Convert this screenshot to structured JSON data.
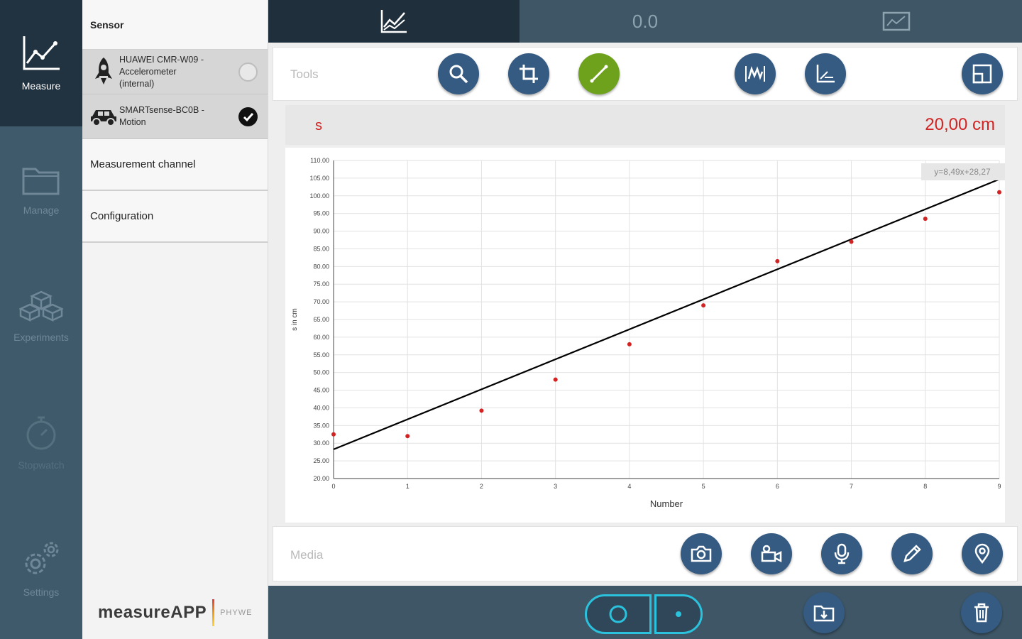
{
  "nav": {
    "items": [
      {
        "label": "Measure",
        "icon": "chart-line-icon",
        "active": true
      },
      {
        "label": "Manage",
        "icon": "folder-icon"
      },
      {
        "label": "Experiments",
        "icon": "cubes-icon"
      },
      {
        "label": "Stopwatch",
        "icon": "stopwatch-icon"
      },
      {
        "label": "Settings",
        "icon": "gears-icon"
      }
    ]
  },
  "panel": {
    "sensor_header": "Sensor",
    "sensors": [
      {
        "line1": "HUAWEI CMR-W09 -",
        "line2": "Accelerometer",
        "line3": "(internal)",
        "selected": false,
        "icon": "rocket-icon"
      },
      {
        "line1": "SMARTsense-BC0B -",
        "line2": "Motion",
        "selected": true,
        "icon": "car-icon"
      }
    ],
    "measurement_channel": "Measurement channel",
    "configuration": "Configuration",
    "brand_app": "measureAPP",
    "brand_company": "PHYWE"
  },
  "topbar": {
    "center_value": "0.0",
    "left_icon": "graph-view-icon",
    "right_icon": "display-view-icon"
  },
  "tools": {
    "label": "Tools",
    "buttons": [
      "zoom-icon",
      "crop-icon",
      "line-fit-icon",
      "curve-fit-icon",
      "axes-icon",
      "expand-icon"
    ]
  },
  "value_bar": {
    "label": "s",
    "value": "20,00 cm"
  },
  "media": {
    "label": "Media",
    "buttons": [
      "camera-icon",
      "video-camera-icon",
      "microphone-icon",
      "pencil-icon",
      "location-icon"
    ]
  },
  "colors": {
    "accent": "#355b82",
    "active_tool": "#6ea21c",
    "value_red": "#d32222",
    "record_ring": "#2bc2de"
  },
  "chart_data": {
    "type": "scatter",
    "xlabel": "Number",
    "ylabel": "s in cm",
    "x_ticks": [
      "0",
      "1",
      "2",
      "3",
      "4",
      "5",
      "6",
      "7",
      "8",
      "9"
    ],
    "y_ticks": [
      "20.00",
      "25.00",
      "30.00",
      "35.00",
      "40.00",
      "45.00",
      "50.00",
      "55.00",
      "60.00",
      "65.00",
      "70.00",
      "75.00",
      "80.00",
      "85.00",
      "90.00",
      "95.00",
      "100.00",
      "105.00",
      "110.00"
    ],
    "xlim": [
      0,
      9
    ],
    "ylim": [
      20,
      110
    ],
    "grid": true,
    "series": [
      {
        "x": [
          0,
          1,
          2,
          3,
          4,
          5,
          6,
          7,
          8,
          9
        ],
        "y": [
          32.5,
          32.0,
          39.2,
          48.0,
          58.0,
          69.0,
          81.5,
          87.0,
          93.5,
          101.0
        ],
        "color": "#d32222"
      }
    ],
    "fit": {
      "equation": "y=8,49x+28,27",
      "slope": 8.49,
      "intercept": 28.27,
      "color": "#000000"
    }
  }
}
